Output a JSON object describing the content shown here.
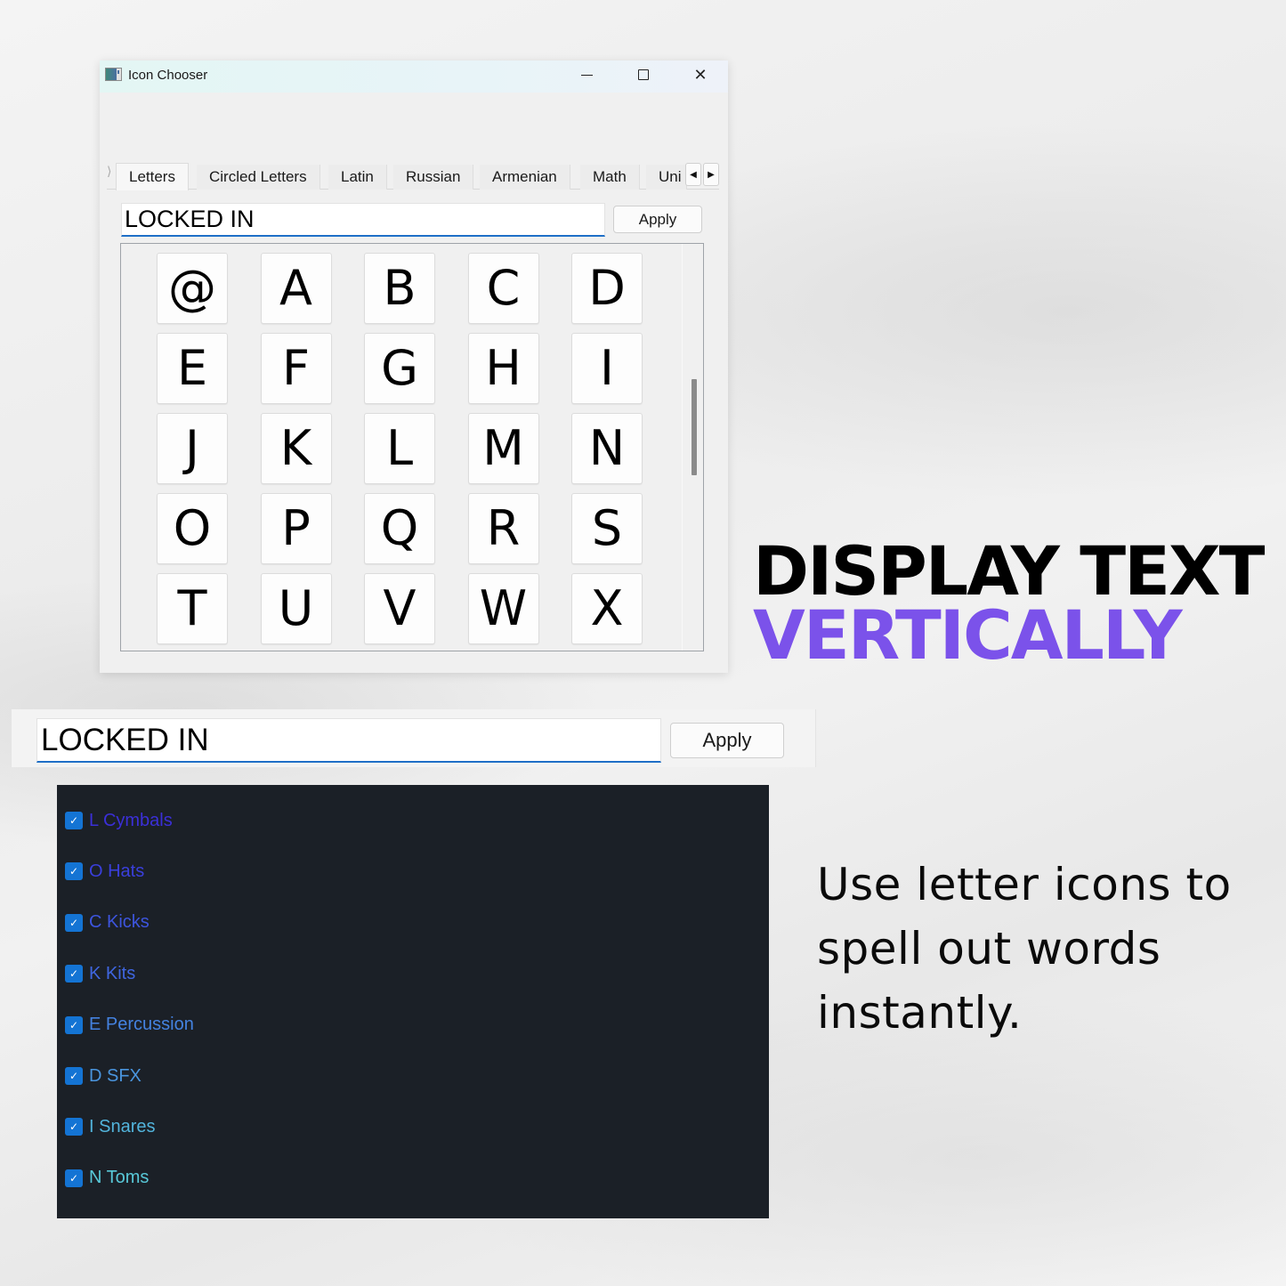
{
  "window": {
    "title": "Icon Chooser",
    "controls": {
      "minimize": "minimize",
      "maximize": "maximize",
      "close": "close"
    },
    "tabs": [
      {
        "label": "Letters",
        "active": true
      },
      {
        "label": "Circled Letters",
        "active": false
      },
      {
        "label": "Latin",
        "active": false
      },
      {
        "label": "Russian",
        "active": false
      },
      {
        "label": "Armenian",
        "active": false
      },
      {
        "label": "Math",
        "active": false
      },
      {
        "label": "Uni",
        "active": false
      }
    ],
    "tab_scroll": {
      "left": "◀",
      "right": "▶"
    },
    "input": {
      "value": "LOCKED IN",
      "placeholder": ""
    },
    "apply_label": "Apply",
    "icons": [
      "@",
      "A",
      "B",
      "C",
      "D",
      "E",
      "F",
      "G",
      "H",
      "I",
      "J",
      "K",
      "L",
      "M",
      "N",
      "O",
      "P",
      "Q",
      "R",
      "S",
      "T",
      "U",
      "V",
      "W",
      "X"
    ]
  },
  "strip": {
    "input": {
      "value": "LOCKED IN"
    },
    "apply_label": "Apply"
  },
  "checklist": {
    "items": [
      {
        "label": "L Cymbals",
        "checked": true,
        "color": "#3b2fd8"
      },
      {
        "label": "O Hats",
        "checked": true,
        "color": "#3a3fdc"
      },
      {
        "label": "C Kicks",
        "checked": true,
        "color": "#3d55de"
      },
      {
        "label": "K Kits",
        "checked": true,
        "color": "#3f66e0"
      },
      {
        "label": "E Percussion",
        "checked": true,
        "color": "#4482e0"
      },
      {
        "label": "D SFX",
        "checked": true,
        "color": "#4a95de"
      },
      {
        "label": "I Snares",
        "checked": true,
        "color": "#52b4dc"
      },
      {
        "label": "N Toms",
        "checked": true,
        "color": "#58c8d8"
      }
    ],
    "check_glyph": "✓"
  },
  "marketing": {
    "headline_line1": "DISPLAY TEXT",
    "headline_line2": "VERTICALLY",
    "accent_color": "#7b52ea",
    "subcopy": "Use letter icons to spell out words instantly."
  }
}
